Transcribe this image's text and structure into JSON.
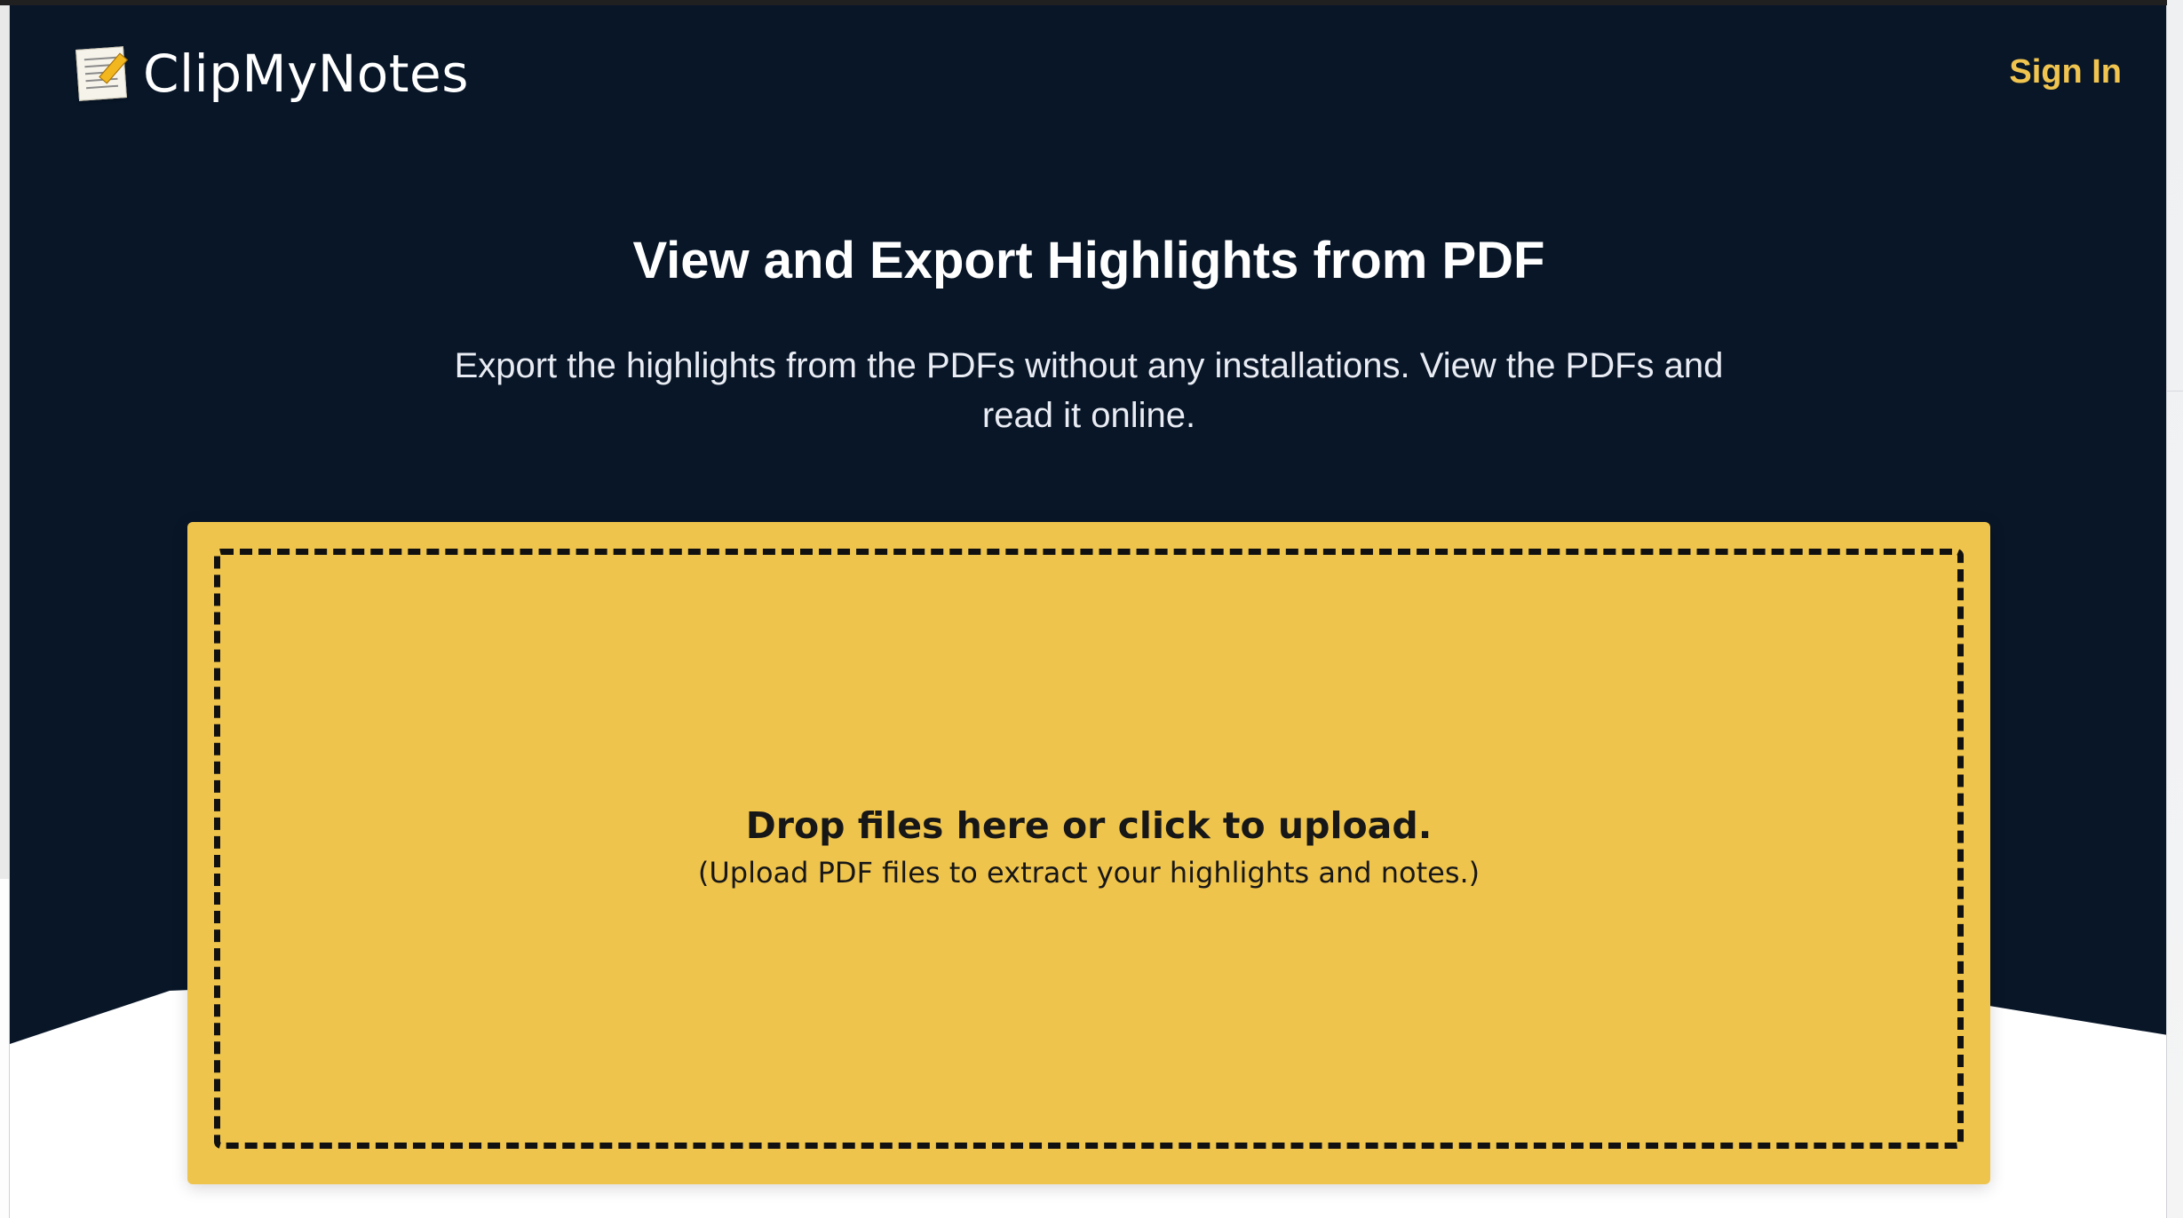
{
  "brand": {
    "name": "ClipMyNotes",
    "icon": "memo-icon"
  },
  "nav": {
    "sign_in_label": "Sign In"
  },
  "hero": {
    "title": "View and Export Highlights from PDF",
    "subtitle": "Export the highlights from the PDFs without any installations. View the PDFs and read it online."
  },
  "upload": {
    "title": "Drop files here or click to upload.",
    "subtitle": "(Upload PDF files to extract your highlights and notes.)"
  },
  "colors": {
    "hero_background": "#081628",
    "accent": "#f0c44f",
    "upload_panel": "#efc44d",
    "text_on_dark": "#ffffff",
    "text_on_light": "#171717"
  }
}
